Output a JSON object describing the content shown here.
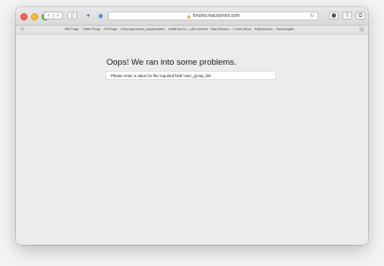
{
  "browser": {
    "url": "forums.macrumors.com",
    "favorites": [
      "MR Purge",
      "Twitter Purge",
      "FB Purge",
      "Onion spectrums_purpleocktree",
      "reddit: the fro...) (No Internet",
      "Mac Rumors: ...2 Care About",
      "Editorial Arra... Technologies"
    ]
  },
  "page": {
    "error_title": "Oops! We ran into some problems.",
    "error_message": "Please enter a value for the required field 'user_group_list'."
  },
  "icons": {
    "lock": "lock-icon",
    "reload": "reload-icon",
    "back": "back-icon",
    "forward": "forward-icon"
  }
}
